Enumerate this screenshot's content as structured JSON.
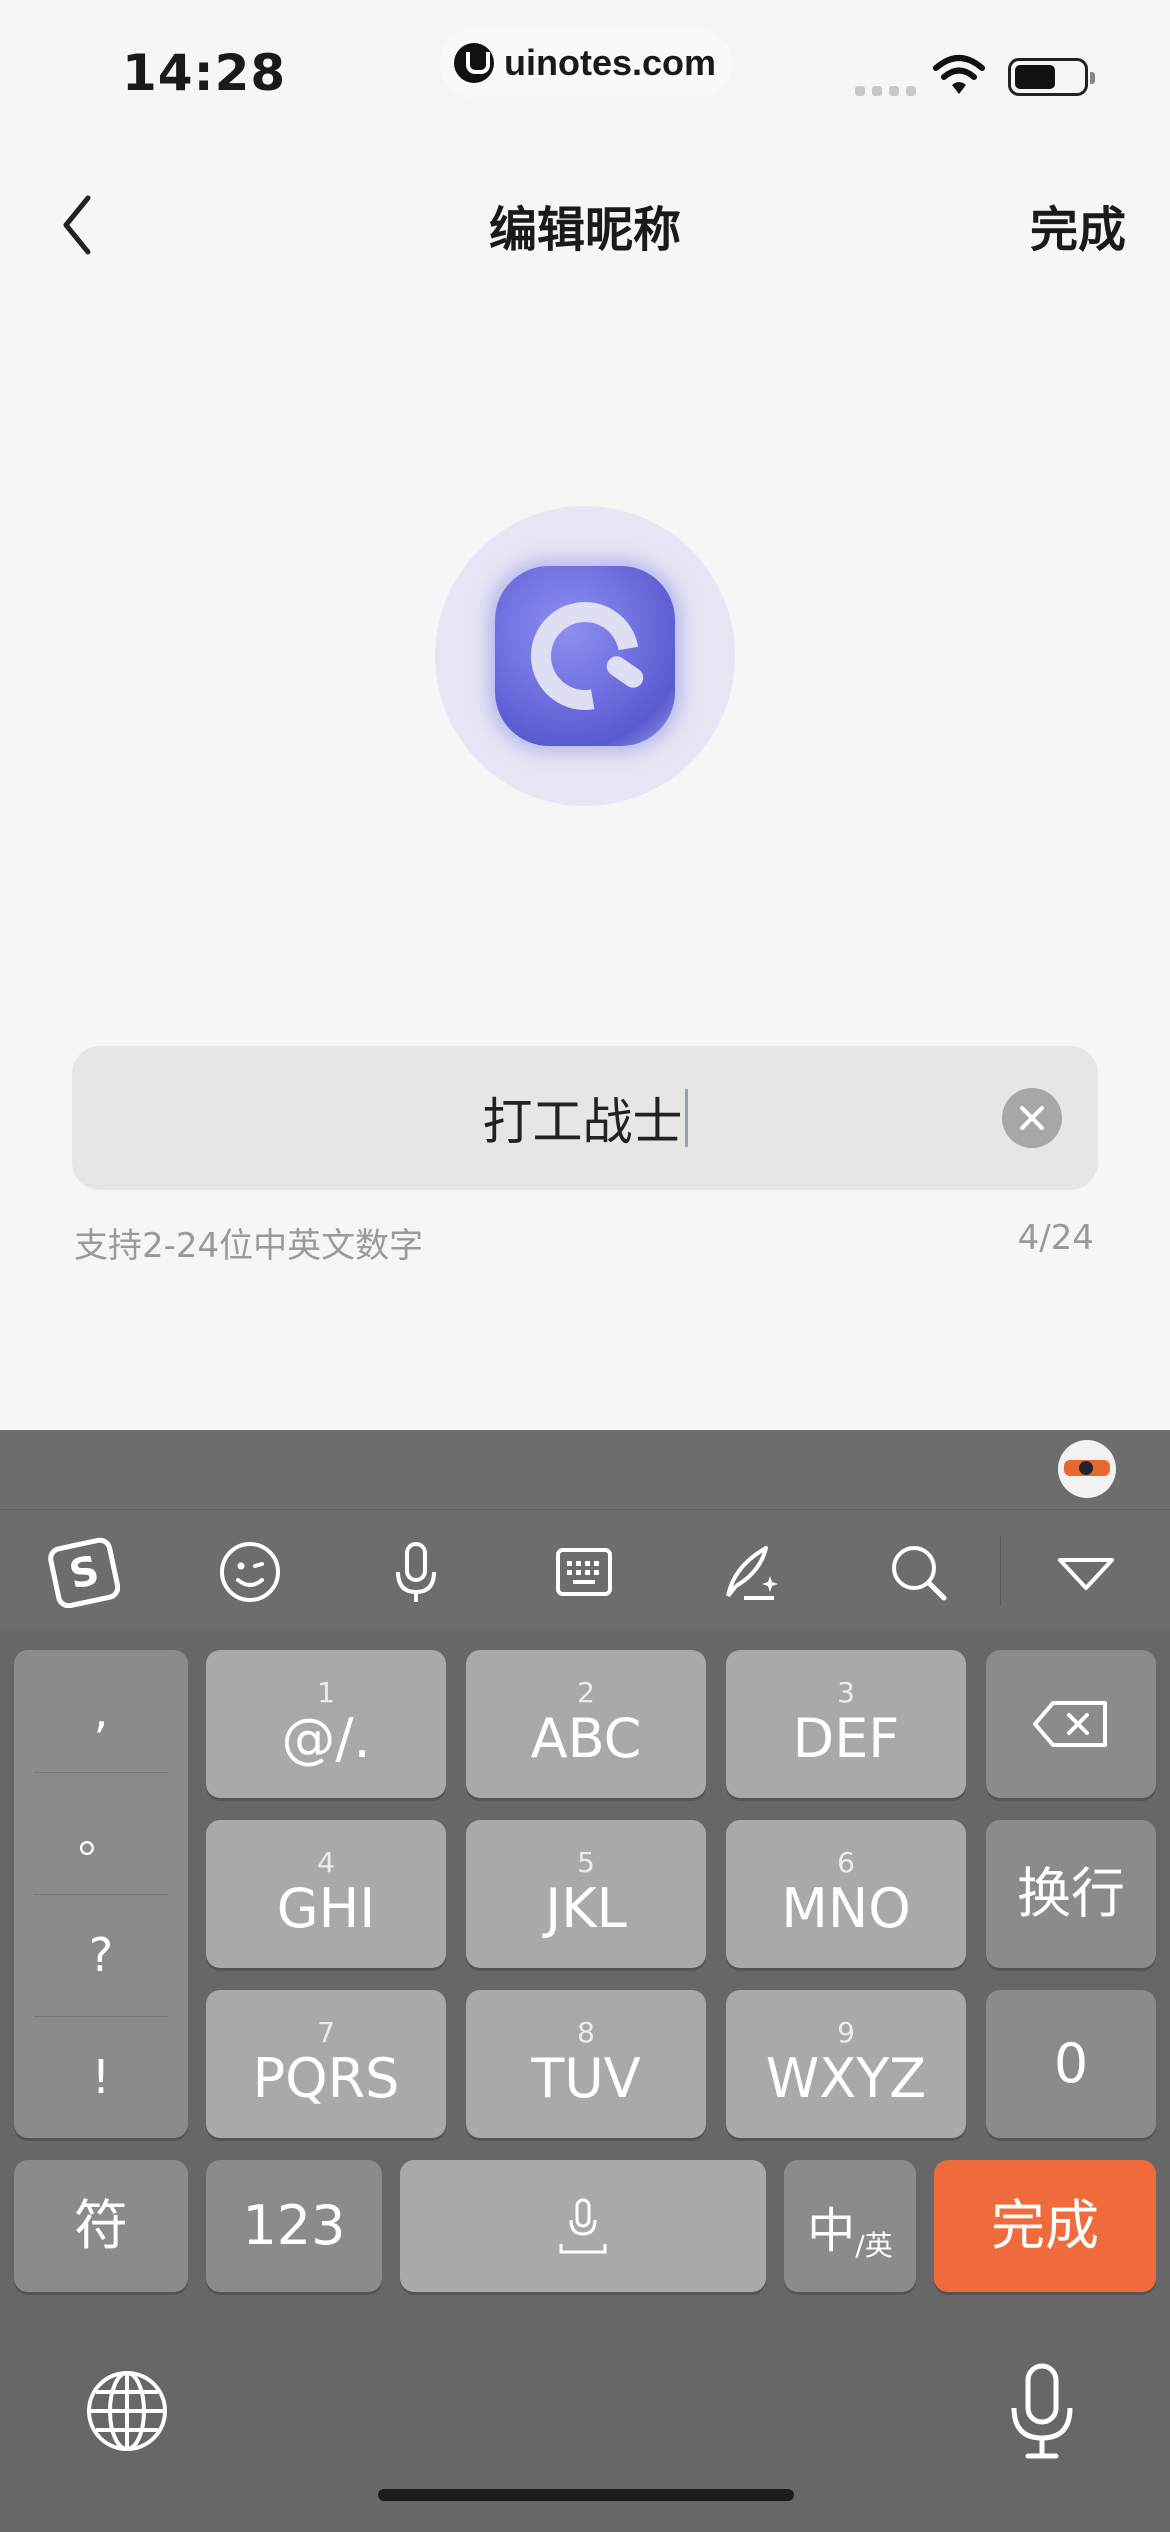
{
  "status_bar": {
    "time": "14:28",
    "url": "uinotes.com"
  },
  "nav": {
    "title": "编辑昵称",
    "done_label": "完成"
  },
  "nickname": {
    "value": "打工战士",
    "hint": "支持2-24位中英文数字",
    "count": "4/24"
  },
  "keyboard": {
    "punctuation": [
      ",",
      "。",
      "?",
      "!"
    ],
    "keys": [
      {
        "num": "1",
        "label": "@/."
      },
      {
        "num": "2",
        "label": "ABC"
      },
      {
        "num": "3",
        "label": "DEF"
      },
      {
        "num": "4",
        "label": "GHI"
      },
      {
        "num": "5",
        "label": "JKL"
      },
      {
        "num": "6",
        "label": "MNO"
      },
      {
        "num": "7",
        "label": "PQRS"
      },
      {
        "num": "8",
        "label": "TUV"
      },
      {
        "num": "9",
        "label": "WXYZ"
      }
    ],
    "newline_label": "换行",
    "zero_label": "0",
    "symbol_label": "符",
    "numbers_label": "123",
    "lang_main": "中",
    "lang_sub": "/英",
    "done_label": "完成",
    "accent_color": "#f06b3c"
  }
}
